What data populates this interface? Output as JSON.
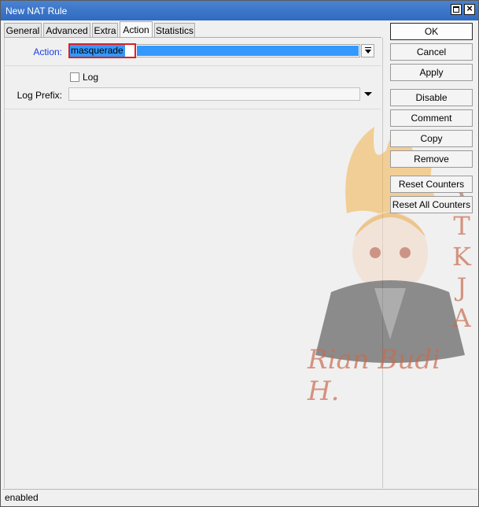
{
  "window": {
    "title": "New NAT Rule"
  },
  "tabs": [
    {
      "label": "General",
      "active": false
    },
    {
      "label": "Advanced",
      "active": false
    },
    {
      "label": "Extra",
      "active": false
    },
    {
      "label": "Action",
      "active": true
    },
    {
      "label": "Statistics",
      "active": false
    }
  ],
  "form": {
    "action_label": "Action:",
    "action_value": "masquerade",
    "log_label": "Log",
    "log_checked": false,
    "log_prefix_label": "Log Prefix:",
    "log_prefix_value": ""
  },
  "buttons": {
    "ok": "OK",
    "cancel": "Cancel",
    "apply": "Apply",
    "disable": "Disable",
    "comment": "Comment",
    "copy": "Copy",
    "remove": "Remove",
    "reset_counters": "Reset Counters",
    "reset_all_counters": "Reset All Counters"
  },
  "status": {
    "text": "enabled"
  },
  "watermark": {
    "name": "Rian Budi H.",
    "side_text": [
      "X",
      "T",
      "K",
      "J",
      "A"
    ]
  },
  "colors": {
    "titlebar": "#2f6bc2",
    "selection": "#3399ff",
    "highlight_box": "#e0201f",
    "label_blue": "#1a3ee0"
  }
}
